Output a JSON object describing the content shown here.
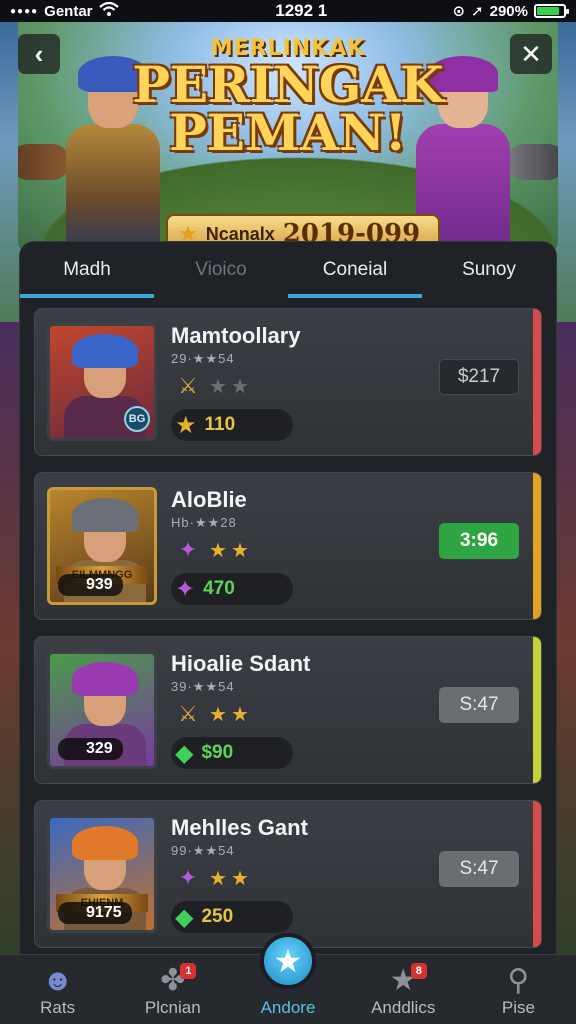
{
  "status": {
    "carrier": "Gentar",
    "time": "1292 1",
    "battery": "290%"
  },
  "banner": {
    "title_small": "MERLINKAK",
    "title_big": "PERINGAK PEMAN!",
    "plaque_label": "Ncanalx",
    "plaque_value": "2019-099"
  },
  "tabs": [
    {
      "label": "Madh",
      "active": true
    },
    {
      "label": "Vioico",
      "active": false
    },
    {
      "label": "Coneial",
      "active": true
    },
    {
      "label": "Sunoy",
      "active": false
    }
  ],
  "cards": [
    {
      "name": "Mamtoollary",
      "sub": "29·★★54",
      "value": "110",
      "price": "$217",
      "badge": "BG",
      "accent": "#d94a4a"
    },
    {
      "name": "AloBlie",
      "sub": "Hb·★★28",
      "value": "470",
      "price": "3:96",
      "level": "939",
      "banner_text": "EILMMNGG",
      "accent": "#e3a226"
    },
    {
      "name": "Hioalie Sdant",
      "sub": "39·★★54",
      "value": "$90",
      "price": "S:47",
      "level": "329",
      "accent": "#c9d13a"
    },
    {
      "name": "Mehlles Gant",
      "sub": "99·★★54",
      "value": "250",
      "price": "S:47",
      "level": "9175",
      "banner_text": "EHIENM",
      "accent": "#d94a4a"
    }
  ],
  "nav": [
    {
      "label": "Rats"
    },
    {
      "label": "Plcnian",
      "badge": "1"
    },
    {
      "label": "Andore"
    },
    {
      "label": "Anddlics",
      "badge": "8"
    },
    {
      "label": "Pise"
    }
  ],
  "colors": {
    "accent_blue": "#3aa9d6",
    "price_green": "#2fa443",
    "gold": "#e7b02e"
  }
}
